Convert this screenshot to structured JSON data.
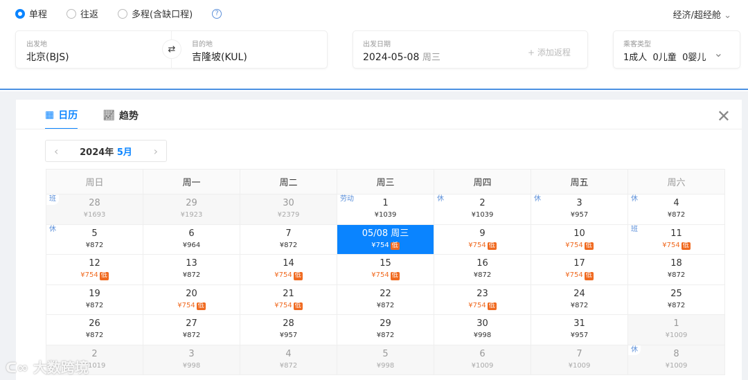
{
  "trip_types": [
    {
      "label": "单程",
      "selected": true
    },
    {
      "label": "往返",
      "selected": false
    },
    {
      "label": "多程(含缺口程)",
      "selected": false
    }
  ],
  "cabin": "经济/超经舱",
  "origin": {
    "label": "出发地",
    "value": "北京(BJS)"
  },
  "destination": {
    "label": "目的地",
    "value": "吉隆坡(KUL)"
  },
  "depart": {
    "label": "出发日期",
    "date": "2024-05-08",
    "weekday": "周三",
    "add_return": "+ 添加返程"
  },
  "passengers": {
    "label": "乘客类型",
    "value": "1成人  0儿童  0婴儿"
  },
  "tabs": [
    {
      "label": "日历",
      "active": true
    },
    {
      "label": "趋势",
      "active": false
    }
  ],
  "month": {
    "year": "2024年",
    "month": "5月"
  },
  "weekdays": [
    "周日",
    "周一",
    "周二",
    "周三",
    "周四",
    "周五",
    "周六"
  ],
  "rows": [
    [
      {
        "d": "28",
        "p": "¥1693",
        "o": true,
        "t": "班"
      },
      {
        "d": "29",
        "p": "¥1923",
        "o": true
      },
      {
        "d": "30",
        "p": "¥2379",
        "o": true
      },
      {
        "d": "1",
        "p": "¥1039",
        "t": "劳动"
      },
      {
        "d": "2",
        "p": "¥1039",
        "t": "休"
      },
      {
        "d": "3",
        "p": "¥957",
        "t": "休"
      },
      {
        "d": "4",
        "p": "¥872",
        "t": "休"
      }
    ],
    [
      {
        "d": "5",
        "p": "¥872",
        "t": "休"
      },
      {
        "d": "6",
        "p": "¥964"
      },
      {
        "d": "7",
        "p": "¥872"
      },
      {
        "d": "05/08 周三",
        "p": "¥754",
        "l": true,
        "s": true
      },
      {
        "d": "9",
        "p": "¥754",
        "l": true
      },
      {
        "d": "10",
        "p": "¥754",
        "l": true
      },
      {
        "d": "11",
        "p": "¥754",
        "l": true,
        "t": "班"
      }
    ],
    [
      {
        "d": "12",
        "p": "¥754",
        "l": true
      },
      {
        "d": "13",
        "p": "¥872"
      },
      {
        "d": "14",
        "p": "¥754",
        "l": true
      },
      {
        "d": "15",
        "p": "¥754",
        "l": true
      },
      {
        "d": "16",
        "p": "¥872"
      },
      {
        "d": "17",
        "p": "¥754",
        "l": true
      },
      {
        "d": "18",
        "p": "¥872"
      }
    ],
    [
      {
        "d": "19",
        "p": "¥872"
      },
      {
        "d": "20",
        "p": "¥754",
        "l": true
      },
      {
        "d": "21",
        "p": "¥754",
        "l": true
      },
      {
        "d": "22",
        "p": "¥872"
      },
      {
        "d": "23",
        "p": "¥754",
        "l": true
      },
      {
        "d": "24",
        "p": "¥872"
      },
      {
        "d": "25",
        "p": "¥872"
      }
    ],
    [
      {
        "d": "26",
        "p": "¥872"
      },
      {
        "d": "27",
        "p": "¥872"
      },
      {
        "d": "28",
        "p": "¥957"
      },
      {
        "d": "29",
        "p": "¥872"
      },
      {
        "d": "30",
        "p": "¥998"
      },
      {
        "d": "31",
        "p": "¥957"
      },
      {
        "d": "1",
        "p": "¥1009",
        "o": true
      }
    ],
    [
      {
        "d": "2",
        "p": "¥1019",
        "o": true
      },
      {
        "d": "3",
        "p": "¥998",
        "o": true
      },
      {
        "d": "4",
        "p": "¥872",
        "o": true
      },
      {
        "d": "5",
        "p": "¥998",
        "o": true
      },
      {
        "d": "6",
        "p": "¥1009",
        "o": true
      },
      {
        "d": "7",
        "p": "¥1009",
        "o": true
      },
      {
        "d": "8",
        "p": "¥1009",
        "o": true,
        "t": "休"
      }
    ]
  ],
  "low_badge": "低",
  "watermark": "大数跨境",
  "colors": {
    "accent": "#0a84ff",
    "low": "#f06a20"
  }
}
